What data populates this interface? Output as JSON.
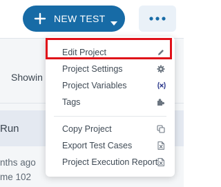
{
  "toolbar": {
    "new_test_label": "NEW TEST"
  },
  "background": {
    "showing_text": "Showin",
    "run_text": "Run",
    "months_ago_text": "nths ago",
    "name_text": "me 102"
  },
  "project_menu": {
    "items": [
      {
        "label": "Edit Project",
        "icon": "pencil-icon"
      },
      {
        "label": "Project Settings",
        "icon": "gear-icon"
      },
      {
        "label": "Project Variables",
        "icon": "variable-x-icon"
      },
      {
        "label": "Tags",
        "icon": "puzzle-icon"
      },
      {
        "label": "Copy Project",
        "icon": "copy-icon"
      },
      {
        "label": "Export Test Cases",
        "icon": "excel-file-icon"
      },
      {
        "label": "Project Execution Report",
        "icon": "excel-file-icon"
      }
    ]
  },
  "colors": {
    "primary": "#176ba6",
    "more_button_bg": "#eaf1f8",
    "highlight": "#e01018",
    "variables_icon": "#2d3a8c"
  }
}
